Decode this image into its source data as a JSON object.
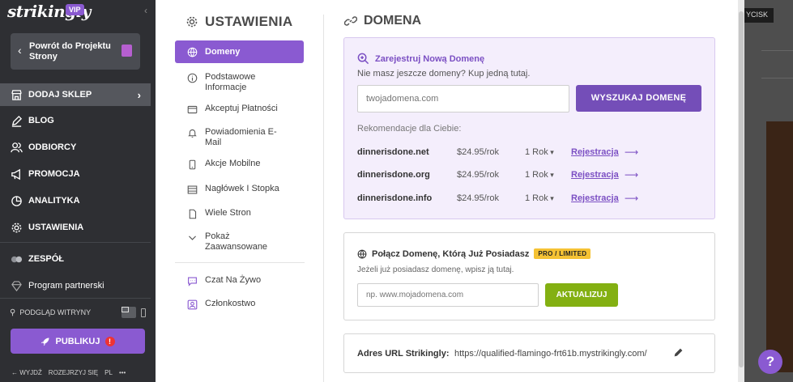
{
  "sidebar": {
    "logo": "strikingly",
    "vip": "VIP",
    "back_label": "Powrót do Projektu Strony",
    "nav": [
      {
        "label": "DODAJ SKLEP",
        "icon": "store-icon"
      },
      {
        "label": "BLOG",
        "icon": "pen-icon"
      },
      {
        "label": "ODBIORCY",
        "icon": "users-icon"
      },
      {
        "label": "PROMOCJA",
        "icon": "megaphone-icon"
      },
      {
        "label": "ANALITYKA",
        "icon": "pie-chart-icon"
      },
      {
        "label": "USTAWIENIA",
        "icon": "gear-icon"
      },
      {
        "label": "ZESPÓŁ",
        "icon": "team-icon"
      },
      {
        "label": "Program partnerski",
        "icon": "diamond-icon"
      }
    ],
    "preview_label": "PODGLĄD WITRYNY",
    "publish_label": "PUBLIKUJ",
    "publish_warning": "!",
    "bottom": [
      "WYJDŹ",
      "ROZEJRZYJ SIĘ",
      "PL",
      "•••"
    ]
  },
  "settings": {
    "title": "USTAWIENIA",
    "menu": [
      {
        "label": "Domeny",
        "icon": "globe-icon"
      },
      {
        "label": "Podstawowe Informacje",
        "icon": "info-icon"
      },
      {
        "label": "Akceptuj Płatności",
        "icon": "card-icon"
      },
      {
        "label": "Powiadomienia E-Mail",
        "icon": "bell-icon"
      },
      {
        "label": "Akcje Mobilne",
        "icon": "mobile-icon"
      },
      {
        "label": "Nagłówek I Stopka",
        "icon": "layout-icon"
      },
      {
        "label": "Wiele Stron",
        "icon": "pages-icon"
      },
      {
        "label": "Pokaż Zaawansowane",
        "icon": "chevron-down-icon"
      },
      {
        "label": "Czat Na Żywo",
        "icon": "chat-icon"
      },
      {
        "label": "Członkostwo",
        "icon": "member-icon"
      }
    ]
  },
  "domain": {
    "title": "DOMENA",
    "register": {
      "title": "Zarejestruj Nową Domenę",
      "subtitle": "Nie masz jeszcze domeny? Kup jedną tutaj.",
      "placeholder": "twojadomena.com",
      "button": "WYSZUKAJ DOMENĘ",
      "rec_label": "Rekomendacje dla Ciebie:",
      "recommendations": [
        {
          "domain": "dinnerisdone.net",
          "price": "$24.95/rok",
          "years": "1 Rok",
          "action": "Rejestracja"
        },
        {
          "domain": "dinnerisdone.org",
          "price": "$24.95/rok",
          "years": "1 Rok",
          "action": "Rejestracja"
        },
        {
          "domain": "dinnerisdone.info",
          "price": "$24.95/rok",
          "years": "1 Rok",
          "action": "Rejestracja"
        }
      ]
    },
    "connect": {
      "title": "Połącz Domenę, Którą Już Posiadasz",
      "badge": "PRO / LIMITED",
      "subtitle": "Jeżeli już posiadasz domenę, wpisz ją tutaj.",
      "placeholder": "np. www.mojadomena.com",
      "button": "AKTUALIZUJ"
    },
    "url": {
      "label": "Adres URL Strikingly:",
      "value": "https://qualified-flamingo-frt61b.mystrikingly.com/"
    }
  },
  "background": {
    "tab_text": "YCISK",
    "help": "?"
  },
  "colors": {
    "accent": "#8a5ad1",
    "sidebar": "#2e2f33",
    "update_button": "#83b012",
    "badge": "#f5c234"
  }
}
